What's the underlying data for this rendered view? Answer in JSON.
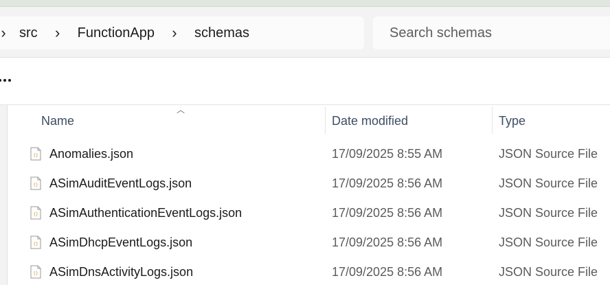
{
  "breadcrumb": {
    "items": [
      {
        "label": "src"
      },
      {
        "label": "FunctionApp"
      },
      {
        "label": "schemas"
      }
    ]
  },
  "search": {
    "placeholder": "Search schemas"
  },
  "columns": {
    "name": "Name",
    "date_modified": "Date modified",
    "type": "Type"
  },
  "files": [
    {
      "name": "Anomalies.json",
      "date": "17/09/2025 8:55 AM",
      "type": "JSON Source File"
    },
    {
      "name": "ASimAuditEventLogs.json",
      "date": "17/09/2025 8:56 AM",
      "type": "JSON Source File"
    },
    {
      "name": "ASimAuthenticationEventLogs.json",
      "date": "17/09/2025 8:56 AM",
      "type": "JSON Source File"
    },
    {
      "name": "ASimDhcpEventLogs.json",
      "date": "17/09/2025 8:56 AM",
      "type": "JSON Source File"
    },
    {
      "name": "ASimDnsActivityLogs.json",
      "date": "17/09/2025 8:56 AM",
      "type": "JSON Source File"
    }
  ],
  "icons": {
    "file": "json-file-icon",
    "more": "more-options-icon",
    "separator": "chevron-right-icon",
    "sort": "sort-ascending-icon"
  },
  "colors": {
    "address_bar_bg": "#f3f3f3",
    "header_text": "#3e4d63",
    "secondary_text": "#5b5b5b",
    "json_icon_accent": "#c9a227"
  }
}
